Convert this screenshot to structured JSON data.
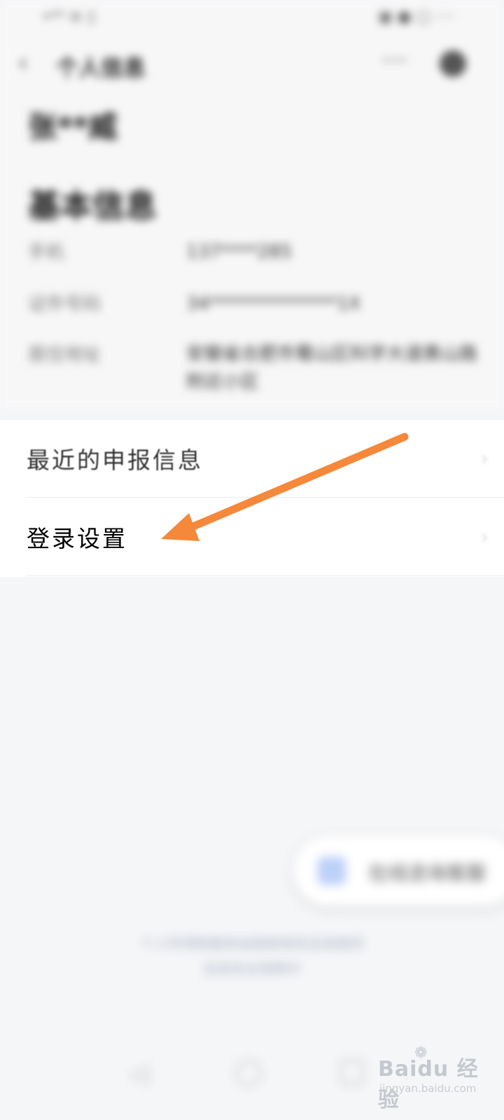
{
  "status_bar": {
    "left": "•ᴬᴬ ≡ ▯",
    "right": "▣ ● ▢ ‧‧‧‧"
  },
  "nav": {
    "back_icon": "chevron-left-icon",
    "title": "个人信息",
    "more_icon": "more-icon",
    "settings_icon": "settings-icon"
  },
  "profile": {
    "name": "张**威"
  },
  "basic_info": {
    "title": "基本信息",
    "rows": [
      {
        "label": "手机",
        "value": "137****285"
      },
      {
        "label": "证件号码",
        "value": "34**************1X"
      },
      {
        "label": "居住地址",
        "value": "安徽省合肥市蜀山区科学大道黄山路附近小区"
      }
    ]
  },
  "menu": {
    "items": [
      {
        "label": "最近的申报信息",
        "chevron": "›"
      },
      {
        "label": "登录设置",
        "chevron": "›"
      }
    ]
  },
  "floating_button": {
    "icon": "service-icon",
    "label": "在线咨询客服"
  },
  "footer": {
    "line1": "个人所得税服务由国家税务总局提供",
    "line2": "信息安全保障中"
  },
  "system_nav": {
    "back": "◁"
  },
  "watermark": {
    "brand": "Baidu 经验",
    "site": "jingyan.baidu.com"
  },
  "colors": {
    "arrow": "#f5883a",
    "background": "#f5f6f8",
    "card": "#ffffff"
  }
}
